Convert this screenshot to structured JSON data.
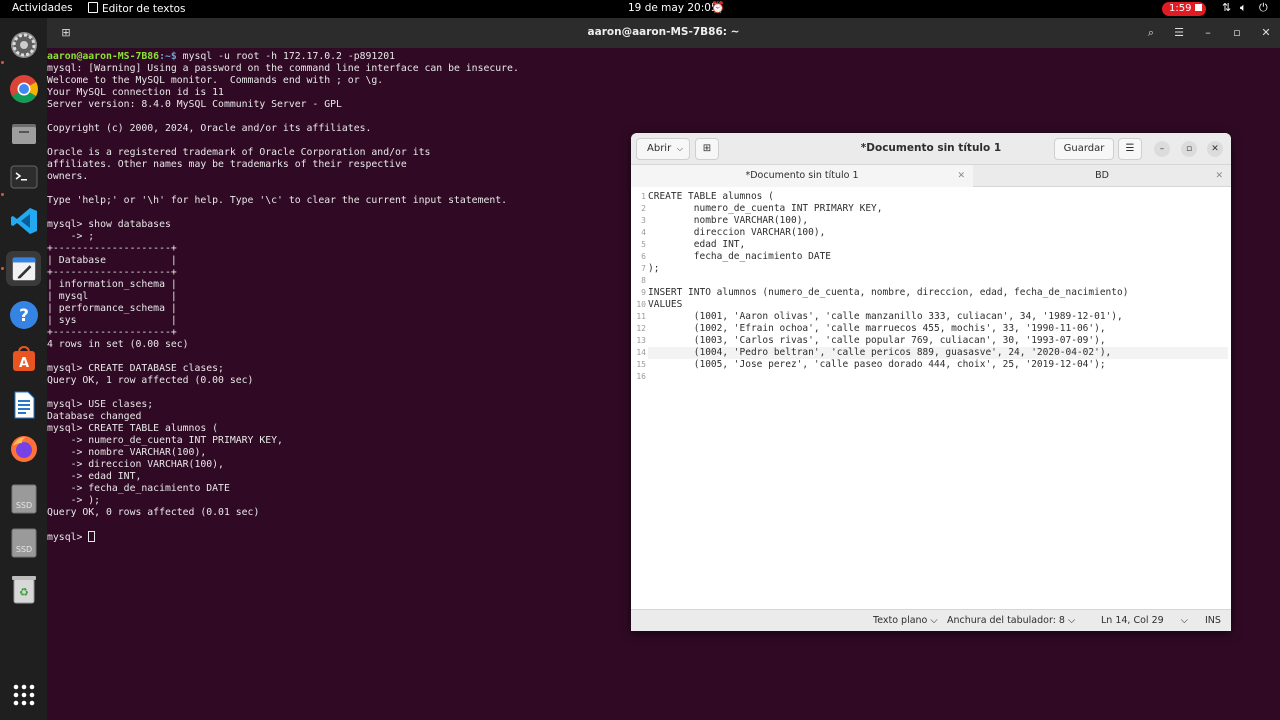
{
  "topbar": {
    "activities": "Actividades",
    "app_name": "Editor de textos",
    "clock": "19 de may  20:05",
    "record_time": "1:59",
    "tray_icons": [
      "network-icon",
      "volume-icon",
      "power-icon"
    ]
  },
  "dock": {
    "items": [
      {
        "name": "settings-icon"
      },
      {
        "name": "chrome-icon"
      },
      {
        "name": "files-icon"
      },
      {
        "name": "terminal-icon"
      },
      {
        "name": "vscode-icon"
      },
      {
        "name": "text-editor-icon"
      },
      {
        "name": "help-icon"
      },
      {
        "name": "software-center-icon"
      },
      {
        "name": "libreoffice-writer-icon"
      },
      {
        "name": "firefox-icon"
      },
      {
        "name": "ssd-drive-icon",
        "label": "SSD"
      },
      {
        "name": "ssd-drive-icon",
        "label": "SSD"
      },
      {
        "name": "trash-icon"
      },
      {
        "name": "app-grid-icon"
      }
    ]
  },
  "terminal": {
    "title": "aaron@aaron-MS-7B86: ~",
    "prompt_user": "aaron@aaron-MS-7B86",
    "prompt_path": ":~$",
    "first_command": " mysql -u root -h 172.17.0.2 -p891201",
    "output": "mysql: [Warning] Using a password on the command line interface can be insecure.\nWelcome to the MySQL monitor.  Commands end with ; or \\g.\nYour MySQL connection id is 11\nServer version: 8.4.0 MySQL Community Server - GPL\n\nCopyright (c) 2000, 2024, Oracle and/or its affiliates.\n\nOracle is a registered trademark of Oracle Corporation and/or its\naffiliates. Other names may be trademarks of their respective\nowners.\n\nType 'help;' or '\\h' for help. Type '\\c' to clear the current input statement.\n\nmysql> show databases\n    -> ;\n+--------------------+\n| Database           |\n+--------------------+\n| information_schema |\n| mysql              |\n| performance_schema |\n| sys                |\n+--------------------+\n4 rows in set (0.00 sec)\n\nmysql> CREATE DATABASE clases;\nQuery OK, 1 row affected (0.00 sec)\n\nmysql> USE clases;\nDatabase changed\nmysql> CREATE TABLE alumnos (\n    -> numero_de_cuenta INT PRIMARY KEY,\n    -> nombre VARCHAR(100),\n    -> direccion VARCHAR(100),\n    -> edad INT,\n    -> fecha_de_nacimiento DATE\n    -> );\nQuery OK, 0 rows affected (0.01 sec)\n\nmysql> "
  },
  "editor": {
    "open_label": "Abrir",
    "title": "*Documento sin título 1",
    "save_label": "Guardar",
    "tabs": [
      {
        "label": "*Documento sin título 1"
      },
      {
        "label": "BD"
      }
    ],
    "lines": [
      "CREATE TABLE alumnos (",
      "        numero_de_cuenta INT PRIMARY KEY,",
      "        nombre VARCHAR(100),",
      "        direccion VARCHAR(100),",
      "        edad INT,",
      "        fecha_de_nacimiento DATE",
      ");",
      "",
      "INSERT INTO alumnos (numero_de_cuenta, nombre, direccion, edad, fecha_de_nacimiento)",
      "VALUES",
      "        (1001, 'Aaron olivas', 'calle manzanillo 333, culiacan', 34, '1989-12-01'),",
      "        (1002, 'Efrain ochoa', 'calle marruecos 455, mochis', 33, '1990-11-06'),",
      "        (1003, 'Carlos rivas', 'calle popular 769, culiacan', 30, '1993-07-09'),",
      "        (1004, 'Pedro beltran', 'calle pericos 889, guasasve', 24, '2020-04-02'),",
      "        (1005, 'Jose perez', 'calle paseo dorado 444, choix', 25, '2019-12-04');",
      ""
    ],
    "current_line": 14,
    "status": {
      "language": "Texto plano",
      "tab_width": "Anchura del tabulador: 8",
      "position": "Ln 14, Col 29",
      "mode": "INS"
    }
  }
}
